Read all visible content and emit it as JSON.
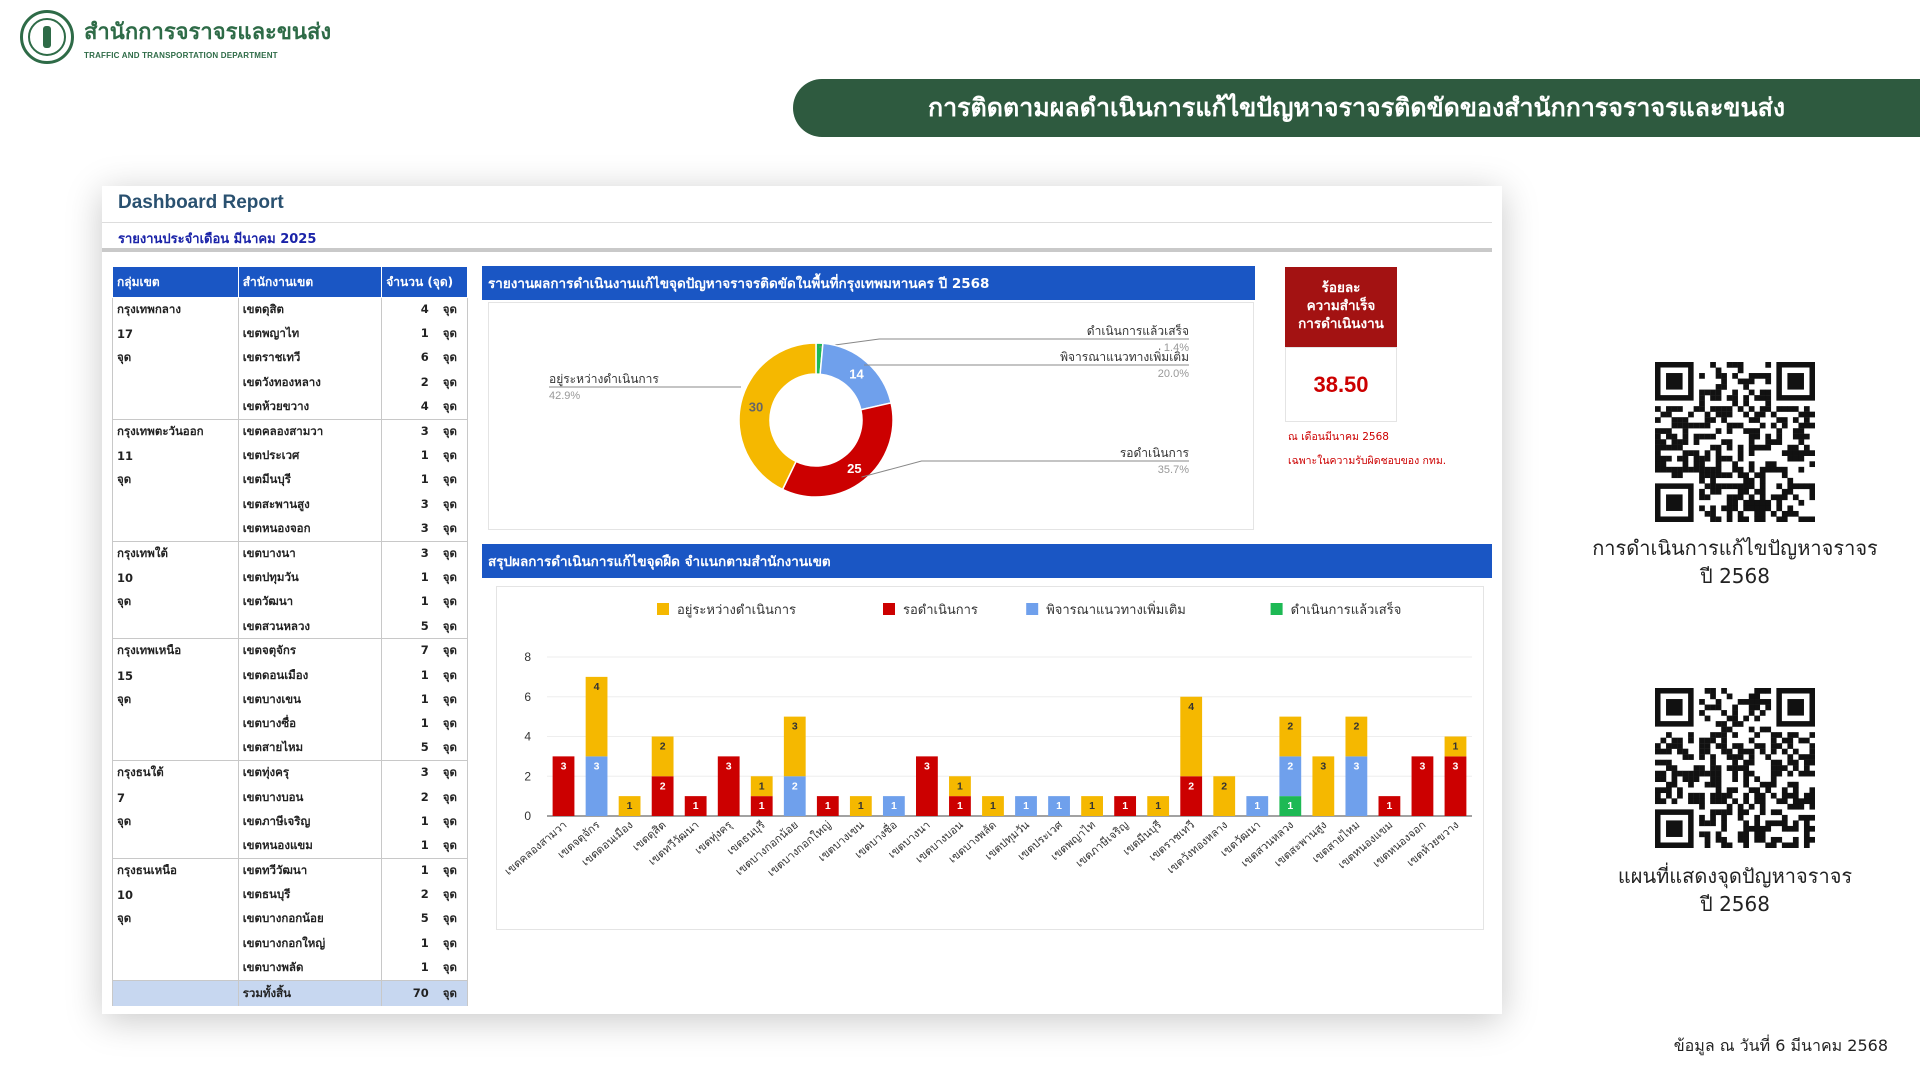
{
  "header": {
    "org_th": "สำนักการจราจรและขนส่ง",
    "org_en": "TRAFFIC AND TRANSPORTATION DEPARTMENT",
    "title": "การติดตามผลดำเนินการแก้ไขปัญหาจราจรติดขัดของสำนักการจราจรและขนส่ง"
  },
  "dashboard": {
    "title": "Dashboard Report",
    "subtitle": "รายงานประจำเดือน มีนาคม 2025"
  },
  "table": {
    "headers": [
      "กลุ่มเขต",
      "สำนักงานเขต",
      "จำนวน (จุด)"
    ],
    "unit": "จุด",
    "groups": [
      {
        "name": "กรุงเทพกลาง",
        "count": "17",
        "unit": "จุด",
        "rows": [
          [
            "เขตดุสิต",
            "4"
          ],
          [
            "เขตพญาไท",
            "1"
          ],
          [
            "เขตราชเทวี",
            "6"
          ],
          [
            "เขตวังทองหลาง",
            "2"
          ],
          [
            "เขตห้วยขวาง",
            "4"
          ]
        ]
      },
      {
        "name": "กรุงเทพตะวันออก",
        "count": "11",
        "unit": "จุด",
        "rows": [
          [
            "เขตคลองสามวา",
            "3"
          ],
          [
            "เขตประเวศ",
            "1"
          ],
          [
            "เขตมีนบุรี",
            "1"
          ],
          [
            "เขตสะพานสูง",
            "3"
          ],
          [
            "เขตหนองจอก",
            "3"
          ]
        ]
      },
      {
        "name": "กรุงเทพใต้",
        "count": "10",
        "unit": "จุด",
        "rows": [
          [
            "เขตบางนา",
            "3"
          ],
          [
            "เขตปทุมวัน",
            "1"
          ],
          [
            "เขตวัฒนา",
            "1"
          ],
          [
            "เขตสวนหลวง",
            "5"
          ]
        ]
      },
      {
        "name": "กรุงเทพเหนือ",
        "count": "15",
        "unit": "จุด",
        "rows": [
          [
            "เขตจตุจักร",
            "7"
          ],
          [
            "เขตดอนเมือง",
            "1"
          ],
          [
            "เขตบางเขน",
            "1"
          ],
          [
            "เขตบางซื่อ",
            "1"
          ],
          [
            "เขตสายไหม",
            "5"
          ]
        ]
      },
      {
        "name": "กรุงธนใต้",
        "count": "7",
        "unit": "จุด",
        "rows": [
          [
            "เขตทุ่งครุ",
            "3"
          ],
          [
            "เขตบางบอน",
            "2"
          ],
          [
            "เขตภาษีเจริญ",
            "1"
          ],
          [
            "เขตหนองแขม",
            "1"
          ]
        ]
      },
      {
        "name": "กรุงธนเหนือ",
        "count": "10",
        "unit": "จุด",
        "rows": [
          [
            "เขตทวีวัฒนา",
            "1"
          ],
          [
            "เขตธนบุรี",
            "2"
          ],
          [
            "เขตบางกอกน้อย",
            "5"
          ],
          [
            "เขตบางกอกใหญ่",
            "1"
          ],
          [
            "เขตบางพลัด",
            "1"
          ]
        ]
      }
    ],
    "total_label": "รวมทั้งสิ้น",
    "total_value": "70",
    "total_unit": "จุด"
  },
  "pie_section_title": "รายงานผลการดำเนินงานแก้ไขจุดปัญหาจราจรติดขัดในพื้นที่กรุงเทพมหานคร ปี 2568",
  "bar_section_title": "สรุปผลการดำเนินการแก้ไขจุดฝืด จำแนกตามสำนักงานเขต",
  "kpi": {
    "label": "ร้อยละ\nความสำเร็จ\nการดำเนินงาน",
    "value": "38.50",
    "note1": "ณ เดือนมีนาคม 2568",
    "note2": "เฉพาะในความรับผิดชอบของ กทม."
  },
  "colors": {
    "in_progress": "#f5b800",
    "waiting": "#cc0000",
    "considering": "#6fa0ec",
    "done": "#1db954",
    "header_green": "#2e5a3f",
    "section_blue": "#1a56c4"
  },
  "chart_data": [
    {
      "type": "pie",
      "variant": "donut",
      "slices": [
        {
          "label": "ดำเนินการแล้วเสร็จ",
          "value": 1,
          "percent": "1.4%",
          "color": "#1db954"
        },
        {
          "label": "พิจารณาแนวทางเพิ่มเติม",
          "value": 14,
          "percent": "20.0%",
          "color": "#6fa0ec"
        },
        {
          "label": "รอดำเนินการ",
          "value": 25,
          "percent": "35.7%",
          "color": "#cc0000"
        },
        {
          "label": "อยู่ระหว่างดำเนินการ",
          "value": 30,
          "percent": "42.9%",
          "color": "#f5b800"
        }
      ]
    },
    {
      "type": "bar",
      "stacked": true,
      "ylim": [
        0,
        8
      ],
      "yticks": [
        0,
        2,
        4,
        6,
        8
      ],
      "legend_position": "top",
      "categories": [
        "เขตคลองสามวา",
        "เขตจตุจักร",
        "เขตดอนเมือง",
        "เขตดุสิต",
        "เขตทวีวัฒนา",
        "เขตทุ่งครุ",
        "เขตธนบุรี",
        "เขตบางกอกน้อย",
        "เขตบางกอกใหญ่",
        "เขตบางเขน",
        "เขตบางซื่อ",
        "เขตบางนา",
        "เขตบางบอน",
        "เขตบางพลัด",
        "เขตปทุมวัน",
        "เขตประเวศ",
        "เขตพญาไท",
        "เขตภาษีเจริญ",
        "เขตมีนบุรี",
        "เขตราชเทวี",
        "เขตวังทองหลาง",
        "เขตวัฒนา",
        "เขตสวนหลวง",
        "เขตสะพานสูง",
        "เขตสายไหม",
        "เขตหนองแขม",
        "เขตหนองจอก",
        "เขตห้วยขวาง"
      ],
      "series": [
        {
          "name": "ดำเนินการแล้วเสร็จ",
          "color": "#1db954",
          "values": [
            0,
            0,
            0,
            0,
            0,
            0,
            0,
            0,
            0,
            0,
            0,
            0,
            0,
            0,
            0,
            0,
            0,
            0,
            0,
            0,
            0,
            0,
            1,
            0,
            0,
            0,
            0,
            0
          ]
        },
        {
          "name": "พิจารณาแนวทางเพิ่มเติม",
          "color": "#6fa0ec",
          "values": [
            0,
            3,
            0,
            0,
            0,
            0,
            0,
            2,
            0,
            0,
            1,
            0,
            0,
            0,
            1,
            1,
            0,
            0,
            0,
            0,
            0,
            1,
            2,
            0,
            3,
            0,
            0,
            0
          ]
        },
        {
          "name": "รอดำเนินการ",
          "color": "#cc0000",
          "values": [
            3,
            0,
            0,
            2,
            1,
            3,
            1,
            0,
            1,
            0,
            0,
            3,
            1,
            0,
            0,
            0,
            0,
            1,
            0,
            2,
            0,
            0,
            0,
            0,
            0,
            1,
            3,
            3
          ]
        },
        {
          "name": "อยู่ระหว่างดำเนินการ",
          "color": "#f5b800",
          "values": [
            0,
            4,
            1,
            2,
            0,
            0,
            1,
            3,
            0,
            1,
            0,
            0,
            1,
            1,
            0,
            0,
            1,
            0,
            1,
            4,
            2,
            0,
            2,
            3,
            2,
            0,
            0,
            1
          ]
        }
      ],
      "legend_order": [
        "อยู่ระหว่างดำเนินการ",
        "รอดำเนินการ",
        "พิจารณาแนวทางเพิ่มเติม",
        "ดำเนินการแล้วเสร็จ"
      ]
    }
  ],
  "qr": [
    {
      "caption_line1": "การดำเนินการแก้ไขปัญหาจราจร",
      "caption_line2": "ปี 2568"
    },
    {
      "caption_line1": "แผนที่แสดงจุดปัญหาจราจร",
      "caption_line2": "ปี 2568"
    }
  ],
  "footnote": "ข้อมูล ณ วันที่ 6 มีนาคม 2568"
}
